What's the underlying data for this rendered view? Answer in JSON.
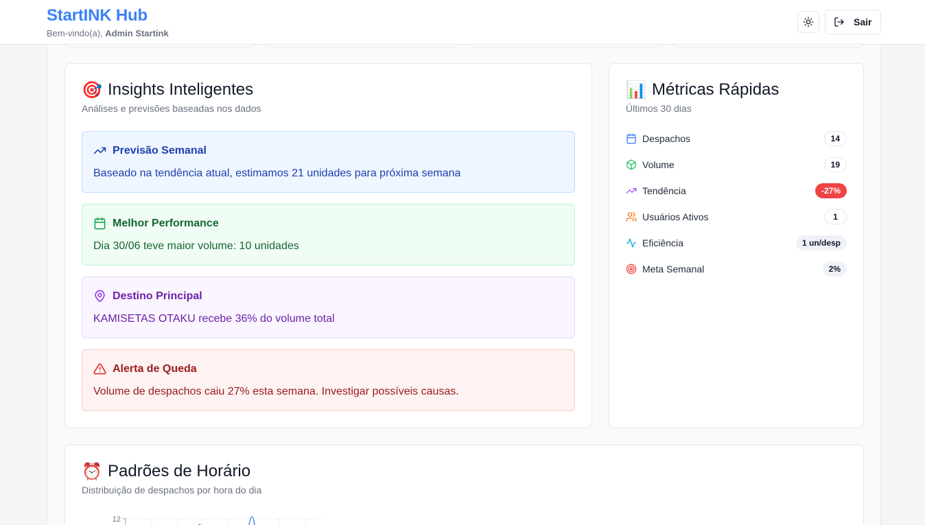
{
  "header": {
    "brand": "StartINK Hub",
    "welcome_prefix": "Bem-vindo(a), ",
    "user_name": "Admin Startink",
    "logout_label": "Sair",
    "theme_icon": "sun-icon",
    "logout_icon": "logout-icon"
  },
  "insights": {
    "emoji": "🎯",
    "title": "Insights Inteligentes",
    "subtitle": "Análises e previsões baseadas nos dados",
    "items": [
      {
        "title": "Previsão Semanal",
        "text": "Baseado na tendência atual, estimamos 21 unidades para próxima semana",
        "icon": "trending-up-icon",
        "color": "#1e40af"
      },
      {
        "title": "Melhor Performance",
        "text": "Dia 30/06 teve maior volume: 10 unidades",
        "icon": "calendar-icon",
        "color": "#166534"
      },
      {
        "title": "Destino Principal",
        "text": "KAMISETAS OTAKU recebe 36% do volume total",
        "icon": "map-pin-icon",
        "color": "#6b21a8"
      },
      {
        "title": "Alerta de Queda",
        "text": "Volume de despachos caiu 27% esta semana. Investigar possíveis causas.",
        "icon": "alert-triangle-icon",
        "color": "#991b1b"
      }
    ]
  },
  "metrics": {
    "emoji": "📊",
    "title": "Métricas Rápidas",
    "subtitle": "Últimos 30 dias",
    "items": [
      {
        "label": "Despachos",
        "value": "14",
        "icon": "calendar-icon",
        "color": "#3b82f6"
      },
      {
        "label": "Volume",
        "value": "19",
        "icon": "package-icon",
        "color": "#22c55e"
      },
      {
        "label": "Tendência",
        "value": "-27%",
        "icon": "trending-up-icon",
        "color": "#a855f7"
      },
      {
        "label": "Usuários Ativos",
        "value": "1",
        "icon": "users-icon",
        "color": "#f97316"
      },
      {
        "label": "Eficiência",
        "value": "1 un/desp",
        "icon": "activity-icon",
        "color": "#06b6d4"
      },
      {
        "label": "Meta Semanal",
        "value": "2%",
        "icon": "target-icon",
        "color": "#ef4444"
      }
    ]
  },
  "hours": {
    "emoji": "⏰",
    "title": "Padrões de Horário",
    "subtitle": "Distribuição de despachos por hora do dia",
    "y_top_tick": "12"
  },
  "colors": {
    "brand": "#3b82f6",
    "danger": "#ef4444"
  }
}
